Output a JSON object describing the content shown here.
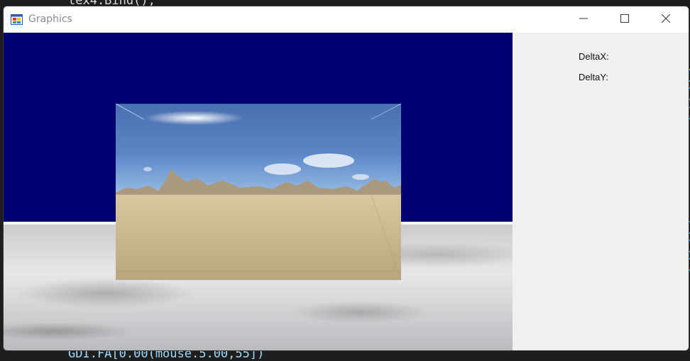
{
  "background_code": {
    "top_line": "tex4.Bind();",
    "bottom_line": "GDI.FA[0.00(mouse.5.00,55])"
  },
  "window": {
    "title": "Graphics",
    "icon": "app-window-icon",
    "controls": {
      "minimize": "minimize-icon",
      "maximize": "maximize-icon",
      "close": "close-icon"
    }
  },
  "viewport": {
    "background_color": "#000070",
    "ground_color": "#d9dadb",
    "skybox_colors": {
      "sky": "#5a86c6",
      "sand": "#cdb98c"
    }
  },
  "panel": {
    "delta_x_label": "DeltaX:",
    "delta_y_label": "DeltaY:"
  }
}
